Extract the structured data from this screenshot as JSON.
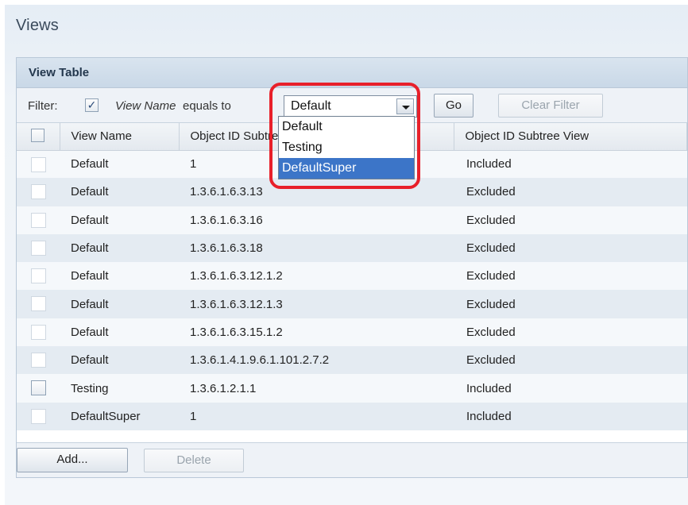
{
  "page": {
    "title": "Views"
  },
  "panel": {
    "header": "View Table"
  },
  "filter": {
    "label": "Filter:",
    "checked_mark": "✓",
    "field": "View Name",
    "operator": "equals to",
    "selected": "Default",
    "options": [
      "Default",
      "Testing",
      "DefaultSuper"
    ],
    "highlighted_option": "DefaultSuper",
    "go_label": "Go",
    "clear_label": "Clear Filter"
  },
  "table": {
    "columns": [
      "View Name",
      "Object ID Subtree",
      "Object ID Subtree View"
    ],
    "rows": [
      {
        "name": "Default",
        "oid": "1",
        "view": "Included"
      },
      {
        "name": "Default",
        "oid": "1.3.6.1.6.3.13",
        "view": "Excluded"
      },
      {
        "name": "Default",
        "oid": "1.3.6.1.6.3.16",
        "view": "Excluded"
      },
      {
        "name": "Default",
        "oid": "1.3.6.1.6.3.18",
        "view": "Excluded"
      },
      {
        "name": "Default",
        "oid": "1.3.6.1.6.3.12.1.2",
        "view": "Excluded"
      },
      {
        "name": "Default",
        "oid": "1.3.6.1.6.3.12.1.3",
        "view": "Excluded"
      },
      {
        "name": "Default",
        "oid": "1.3.6.1.6.3.15.1.2",
        "view": "Excluded"
      },
      {
        "name": "Default",
        "oid": "1.3.6.1.4.1.9.6.1.101.2.7.2",
        "view": "Excluded"
      },
      {
        "name": "Testing",
        "oid": "1.3.6.1.2.1.1",
        "view": "Included"
      },
      {
        "name": "DefaultSuper",
        "oid": "1",
        "view": "Included"
      }
    ]
  },
  "footer": {
    "add_label": "Add...",
    "delete_label": "Delete"
  },
  "colors": {
    "highlight_ring": "#e8202a",
    "selected_option": "#3c75c8"
  }
}
